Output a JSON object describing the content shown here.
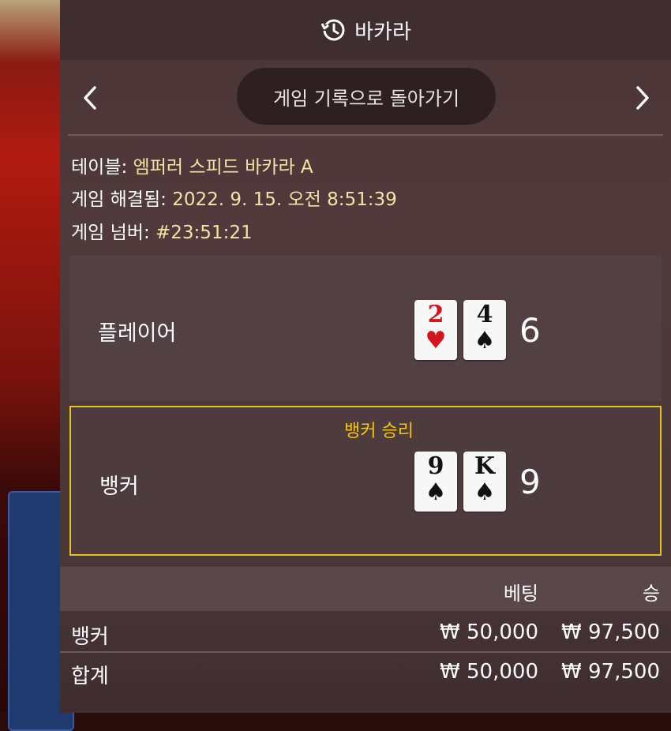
{
  "header": {
    "title": "바카라",
    "back_button": "게임 기록으로 돌아가기"
  },
  "info": {
    "table_label": "테이블:",
    "table_value": "엠퍼러 스피드 바카라 A",
    "resolved_label": "게임 해결됨:",
    "resolved_value": "2022. 9. 15. 오전 8:51:39",
    "number_label": "게임 넘버:",
    "number_value": "#23:51:21"
  },
  "player": {
    "label": "플레이어",
    "cards": [
      {
        "rank": "2",
        "suit": "♥",
        "color": "#d4161c"
      },
      {
        "rank": "4",
        "suit": "♠",
        "color": "#111111"
      }
    ],
    "score": "6"
  },
  "banker": {
    "label": "뱅커",
    "winner_text": "뱅커 승리",
    "cards": [
      {
        "rank": "9",
        "suit": "♠",
        "color": "#111111"
      },
      {
        "rank": "K",
        "suit": "♠",
        "color": "#111111"
      }
    ],
    "score": "9"
  },
  "bets_table": {
    "headers": {
      "bet": "베팅",
      "win": "승"
    },
    "rows": [
      {
        "name": "뱅커",
        "bet": "₩ 50,000",
        "win": "₩ 97,500"
      }
    ],
    "total": {
      "name": "합계",
      "bet": "₩ 50,000",
      "win": "₩ 97,500"
    }
  },
  "colors": {
    "winner_highlight": "#e3c41f",
    "info_value": "#f6e2a8",
    "panel_bg": "#4a3537"
  },
  "icons": {
    "title": "history-icon",
    "nav_prev": "chevron-left-icon",
    "nav_next": "chevron-right-icon"
  }
}
